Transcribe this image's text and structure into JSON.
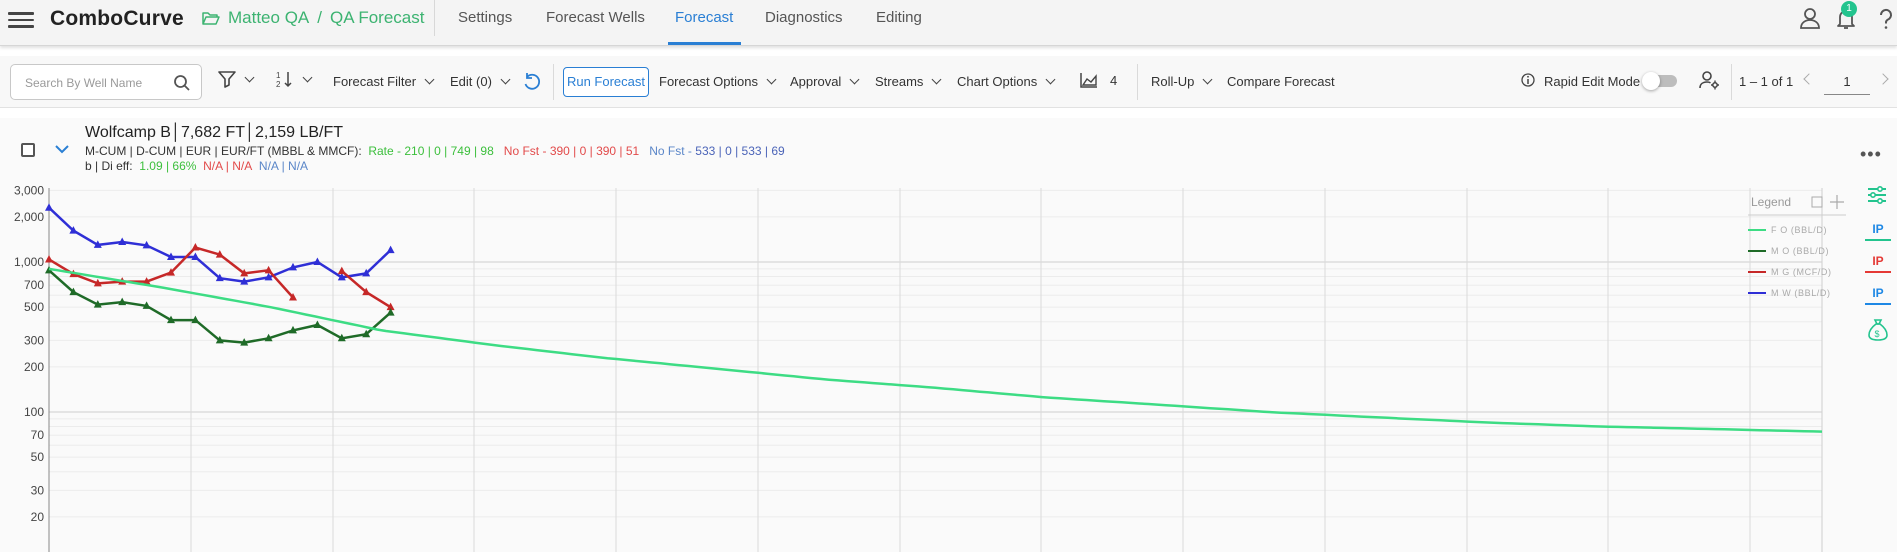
{
  "app": {
    "name": "ComboCurve"
  },
  "breadcrumb": {
    "project": "Matteo QA",
    "separator": "/",
    "scenario": "QA Forecast"
  },
  "nav": {
    "tabs": [
      "Settings",
      "Forecast Wells",
      "Forecast",
      "Diagnostics",
      "Editing"
    ],
    "active": "Forecast"
  },
  "notifications": {
    "count": "1"
  },
  "toolbar": {
    "search_placeholder": "Search By Well Name",
    "forecast_filter": "Forecast Filter",
    "edit": "Edit (0)",
    "run_forecast": "Run Forecast",
    "forecast_options": "Forecast Options",
    "approval": "Approval",
    "streams": "Streams",
    "chart_options": "Chart Options",
    "chart_count": "4",
    "roll_up": "Roll-Up",
    "compare_forecast": "Compare Forecast",
    "rapid_edit_mode": "Rapid Edit Mode",
    "rapid_edit_enabled": false,
    "pagination": "1 – 1 of 1",
    "page": "1"
  },
  "well": {
    "title": "Wolfcamp B│7,682 FT│2,159 LB/FT",
    "metrics_label": "M-CUM | D-CUM | EUR | EUR/FT (MBBL & MMCF):",
    "rate_label": "Rate - ",
    "rate_values": "210 | 0 | 749 | 98",
    "nofst_label": "No Fst - ",
    "nofst_values": "390 | 0 | 390 | 51",
    "nofst2_label": "No Fst - ",
    "nofst2_values": "533 | 0 | 533 | 69",
    "bdi_label": "b | Di eff:",
    "bdi_green": "1.09 | 66%",
    "bdi_red": "N/A | N/A",
    "bdi_blue": "N/A | N/A"
  },
  "colors": {
    "accent": "#2a7fd4",
    "brand_green": "#3cb371",
    "forecast_oil": "#3ddc84",
    "monthly_oil": "#1f6b28",
    "monthly_gas": "#c62828",
    "monthly_water": "#2f2fd6"
  },
  "legend": {
    "title": "Legend",
    "items": [
      "F O (BBL/D)",
      "M O (BBL/D)",
      "M G (MCF/D)",
      "M W (BBL/D)"
    ]
  },
  "side_tools": {
    "ip_labels": [
      "IP",
      "IP",
      "IP"
    ]
  },
  "chart_data": {
    "type": "line",
    "y_scale": "log",
    "y_ticks": [
      "3,000",
      "2,000",
      "1,000",
      "700",
      "500",
      "300",
      "200",
      "100",
      "70",
      "50",
      "30",
      "20"
    ],
    "y_tick_values": [
      3000,
      2000,
      1000,
      700,
      500,
      300,
      200,
      100,
      70,
      50,
      30,
      20
    ],
    "grid": true,
    "legend_position": "top-right",
    "series": [
      {
        "name": "M W (BBL/D)",
        "marker": "triangle",
        "values": [
          2300,
          1620,
          1300,
          1360,
          1290,
          1080,
          1080,
          780,
          740,
          790,
          920,
          1000,
          790,
          840,
          1200
        ]
      },
      {
        "name": "M G (MCF/D)",
        "marker": "triangle",
        "values": [
          1040,
          830,
          720,
          740,
          740,
          850,
          1250,
          1120,
          840,
          880,
          580,
          null,
          870,
          630,
          500
        ]
      },
      {
        "name": "M O (BBL/D)",
        "marker": "triangle",
        "values": [
          880,
          630,
          520,
          540,
          510,
          410,
          410,
          300,
          290,
          310,
          350,
          380,
          310,
          330,
          460
        ]
      },
      {
        "name": "F O (BBL/D)",
        "marker": "none",
        "values": [
          900,
          680,
          500,
          350,
          280,
          230,
          195,
          165,
          145,
          125,
          112,
          100,
          92,
          85,
          80,
          77,
          74
        ]
      }
    ]
  }
}
